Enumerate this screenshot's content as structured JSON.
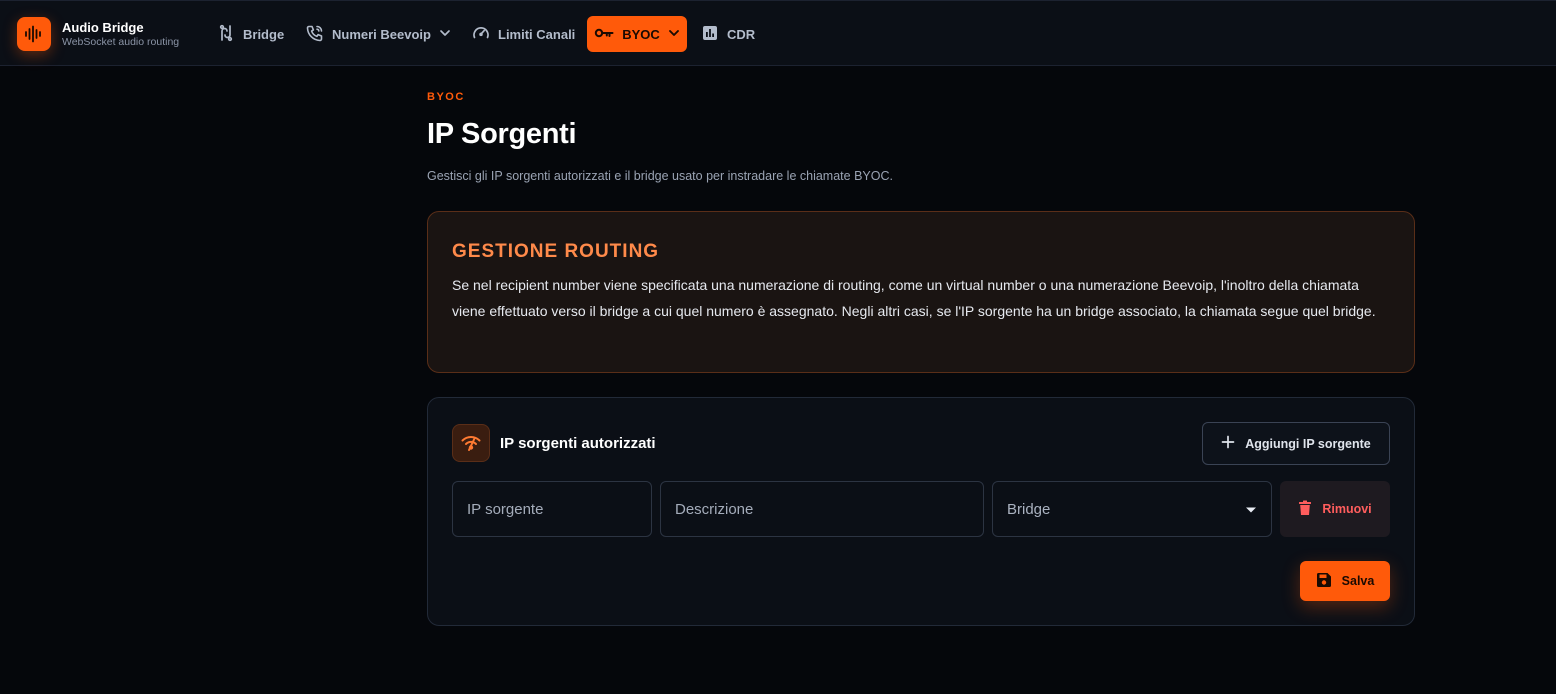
{
  "brand": {
    "title": "Audio Bridge",
    "subtitle": "WebSocket audio routing"
  },
  "nav": {
    "items": [
      {
        "label": "Bridge",
        "icon": "bridge-icon"
      },
      {
        "label": "Numeri Beevoip",
        "icon": "phone-icon",
        "dropdown": true
      },
      {
        "label": "Limiti Canali",
        "icon": "gauge-icon"
      },
      {
        "label": "BYOC",
        "icon": "key-icon",
        "dropdown": true,
        "active": true
      },
      {
        "label": "CDR",
        "icon": "bar-chart-icon"
      }
    ]
  },
  "page": {
    "eyebrow": "BYOC",
    "title": "IP Sorgenti",
    "description": "Gestisci gli IP sorgenti autorizzati e il bridge usato per instradare le chiamate BYOC."
  },
  "routing": {
    "title": "GESTIONE ROUTING",
    "text": "Se nel recipient number viene specificata una numerazione di routing, come un virtual number o una numerazione Beevoip, l'inoltro della chiamata viene effettuato verso il bridge a cui quel numero è assegnato. Negli altri casi, se l'IP sorgente ha un bridge associato, la chiamata segue quel bridge."
  },
  "ip_card": {
    "title": "IP sorgenti autorizzati",
    "add_label": "Aggiungi IP sorgente",
    "fields": {
      "ip_placeholder": "IP sorgente",
      "ip_value": "",
      "description_placeholder": "Descrizione",
      "description_value": "",
      "bridge_selected": "Bridge"
    },
    "remove_label": "Rimuovi",
    "save_label": "Salva"
  },
  "colors": {
    "accent": "#ff5a0a",
    "danger": "#ff5d5d",
    "background": "#05070b"
  }
}
